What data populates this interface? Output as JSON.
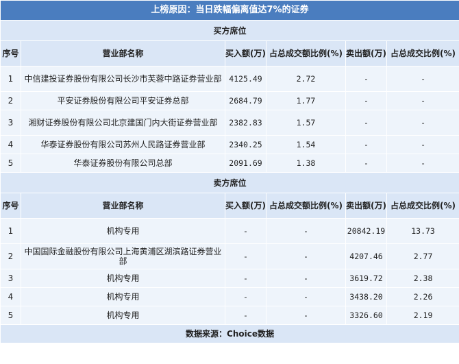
{
  "title": "上榜原因：当日跌幅偏离值达7%的证券",
  "buy_section": {
    "label": "买方席位",
    "headers": [
      "序号",
      "营业部名称",
      "买入额(万)",
      "占总成交额比例(%)",
      "卖出额(万)",
      "占总成交比例(%)"
    ],
    "rows": [
      [
        "1",
        "中信建投证券股份有限公司长沙市芙蓉中路证券营业部",
        "4125.49",
        "2.72",
        "-",
        "-"
      ],
      [
        "2",
        "平安证券股份有限公司平安证券总部",
        "2684.79",
        "1.77",
        "-",
        "-"
      ],
      [
        "3",
        "湘财证券股份有限公司北京建国门内大街证券营业部",
        "2382.83",
        "1.57",
        "-",
        "-"
      ],
      [
        "4",
        "华泰证券股份有限公司苏州人民路证券营业部",
        "2340.25",
        "1.54",
        "-",
        "-"
      ],
      [
        "5",
        "华泰证券股份有限公司总部",
        "2091.69",
        "1.38",
        "-",
        "-"
      ]
    ]
  },
  "sell_section": {
    "label": "卖方席位",
    "headers": [
      "序号",
      "营业部名称",
      "买入额(万)",
      "占总成交额比例(%)",
      "卖出额(万)",
      "占总成交比例(%)"
    ],
    "rows": [
      [
        "1",
        "机构专用",
        "-",
        "-",
        "20842.19",
        "13.73"
      ],
      [
        "2",
        "中国国际金融股份有限公司上海黄浦区湖滨路证券营业部",
        "-",
        "-",
        "4207.46",
        "2.77"
      ],
      [
        "3",
        "机构专用",
        "-",
        "-",
        "3619.72",
        "2.38"
      ],
      [
        "4",
        "机构专用",
        "-",
        "-",
        "3438.20",
        "2.26"
      ],
      [
        "5",
        "机构专用",
        "-",
        "-",
        "3326.60",
        "2.19"
      ]
    ]
  },
  "footer": "数据来源：Choice数据"
}
